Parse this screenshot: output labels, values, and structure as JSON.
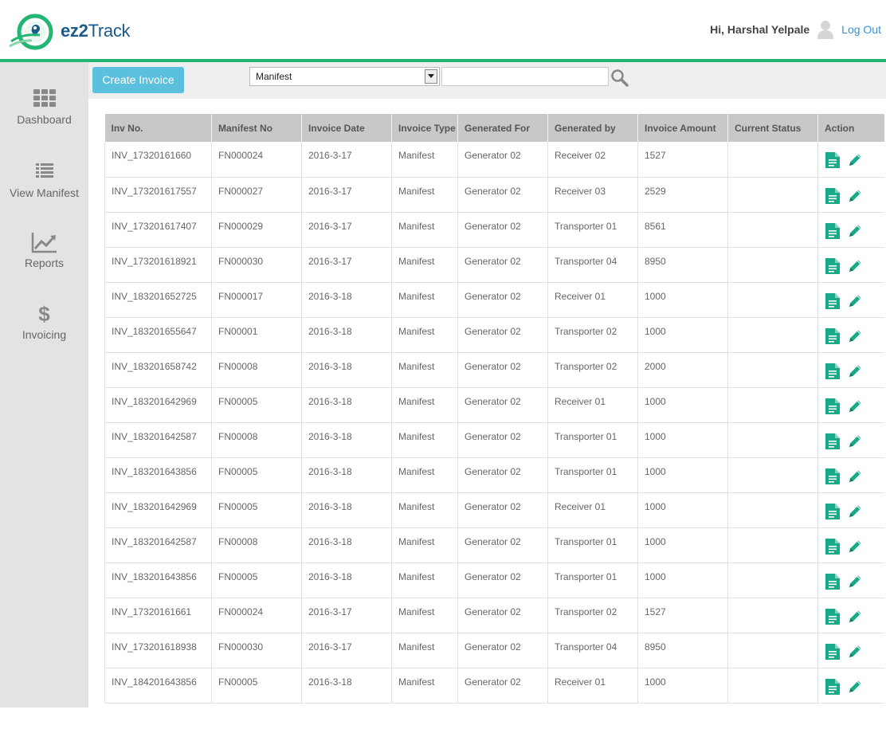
{
  "header": {
    "logo": {
      "brand_bold": "ez2",
      "brand_rest": "Track"
    },
    "greeting": "Hi, Harshal Yelpale",
    "logout_label": "Log Out"
  },
  "sidebar": {
    "items": [
      {
        "label": "Dashboard",
        "icon": "grid-icon"
      },
      {
        "label": "View Manifest",
        "icon": "list-icon"
      },
      {
        "label": "Reports",
        "icon": "chart-icon"
      },
      {
        "label": "Invoicing",
        "icon": "dollar-icon"
      }
    ]
  },
  "toolbar": {
    "create_label": "Create Invoice",
    "filter_selected": "Manifest",
    "search_value": ""
  },
  "table": {
    "columns": [
      "Inv No.",
      "Manifest No",
      "Invoice Date",
      "Invoice Type",
      "Generated For",
      "Generated by",
      "Invoice Amount",
      "Current Status",
      "Action"
    ],
    "rows": [
      [
        "INV_17320161660",
        "FN000024",
        "2016-3-17",
        "Manifest",
        "Generator 02",
        "Receiver 02",
        "1527",
        ""
      ],
      [
        "INV_173201617557",
        "FN000027",
        "2016-3-17",
        "Manifest",
        "Generator 02",
        "Receiver 03",
        "2529",
        ""
      ],
      [
        "INV_173201617407",
        "FN000029",
        "2016-3-17",
        "Manifest",
        "Generator 02",
        "Transporter 01",
        "8561",
        ""
      ],
      [
        "INV_173201618921",
        "FN000030",
        "2016-3-17",
        "Manifest",
        "Generator 02",
        "Transporter 04",
        "8950",
        ""
      ],
      [
        "INV_183201652725",
        "FN000017",
        "2016-3-18",
        "Manifest",
        "Generator 02",
        "Receiver 01",
        "1000",
        ""
      ],
      [
        "INV_183201655647",
        "FN00001",
        "2016-3-18",
        "Manifest",
        "Generator 02",
        "Transporter 02",
        "1000",
        ""
      ],
      [
        "INV_183201658742",
        "FN00008",
        "2016-3-18",
        "Manifest",
        "Generator 02",
        "Transporter 02",
        "2000",
        ""
      ],
      [
        "INV_183201642969",
        "FN00005",
        "2016-3-18",
        "Manifest",
        "Generator 02",
        "Receiver 01",
        "1000",
        ""
      ],
      [
        "INV_183201642587",
        "FN00008",
        "2016-3-18",
        "Manifest",
        "Generator 02",
        "Transporter 01",
        "1000",
        ""
      ],
      [
        "INV_183201643856",
        "FN00005",
        "2016-3-18",
        "Manifest",
        "Generator 02",
        "Transporter 01",
        "1000",
        ""
      ],
      [
        "INV_183201642969",
        "FN00005",
        "2016-3-18",
        "Manifest",
        "Generator 02",
        "Receiver 01",
        "1000",
        ""
      ],
      [
        "INV_183201642587",
        "FN00008",
        "2016-3-18",
        "Manifest",
        "Generator 02",
        "Transporter 01",
        "1000",
        ""
      ],
      [
        "INV_183201643856",
        "FN00005",
        "2016-3-18",
        "Manifest",
        "Generator 02",
        "Transporter 01",
        "1000",
        ""
      ],
      [
        "INV_17320161661",
        "FN000024",
        "2016-3-17",
        "Manifest",
        "Generator 02",
        "Transporter 02",
        "1527",
        ""
      ],
      [
        "INV_173201618938",
        "FN000030",
        "2016-3-17",
        "Manifest",
        "Generator 02",
        "Transporter 04",
        "8950",
        ""
      ],
      [
        "INV_184201643856",
        "FN00005",
        "2016-3-18",
        "Manifest",
        "Generator 02",
        "Receiver 01",
        "1000",
        ""
      ]
    ],
    "action_icons": [
      "document-icon",
      "pencil-icon"
    ]
  },
  "colors": {
    "accent_green": "#22b573",
    "brand_blue": "#1c5a8a",
    "create_button": "#5bc0de",
    "link_blue": "#3a8fd6",
    "icon_teal": "#1aaa8a",
    "sidebar_bg": "#e3e3e3",
    "header_row": "#c8c8c8"
  }
}
